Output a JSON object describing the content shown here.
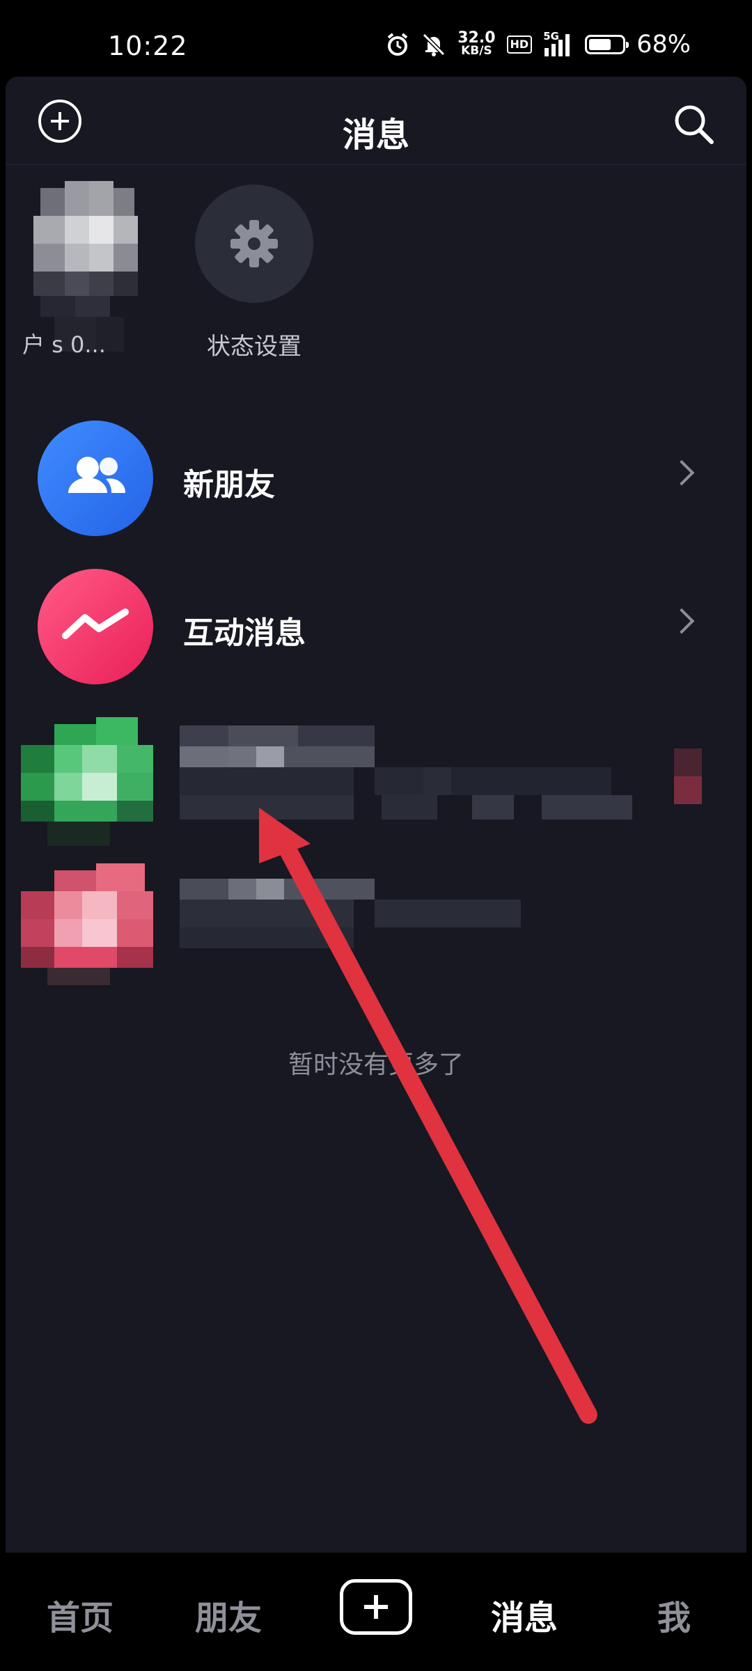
{
  "status_bar": {
    "time": "10:22",
    "speed_value": "32.0",
    "speed_unit": "KB/S",
    "hd_label": "HD",
    "network_label": "5G",
    "battery_percent": "68%",
    "battery_level": 0.68
  },
  "header": {
    "title": "消息"
  },
  "stories": {
    "user_label": "户 s 0...",
    "status_label": "状态设置"
  },
  "list": {
    "new_friends": "新朋友",
    "interactions": "互动消息"
  },
  "empty_text": "暂时没有更多了",
  "bottom_nav": {
    "home": "首页",
    "friends": "朋友",
    "messages": "消息",
    "me": "我"
  },
  "colors": {
    "background": "#171821",
    "new_friends_icon": "#3478ff",
    "interactions_icon": "#f53b6d",
    "annotation_arrow": "#e0323f"
  }
}
